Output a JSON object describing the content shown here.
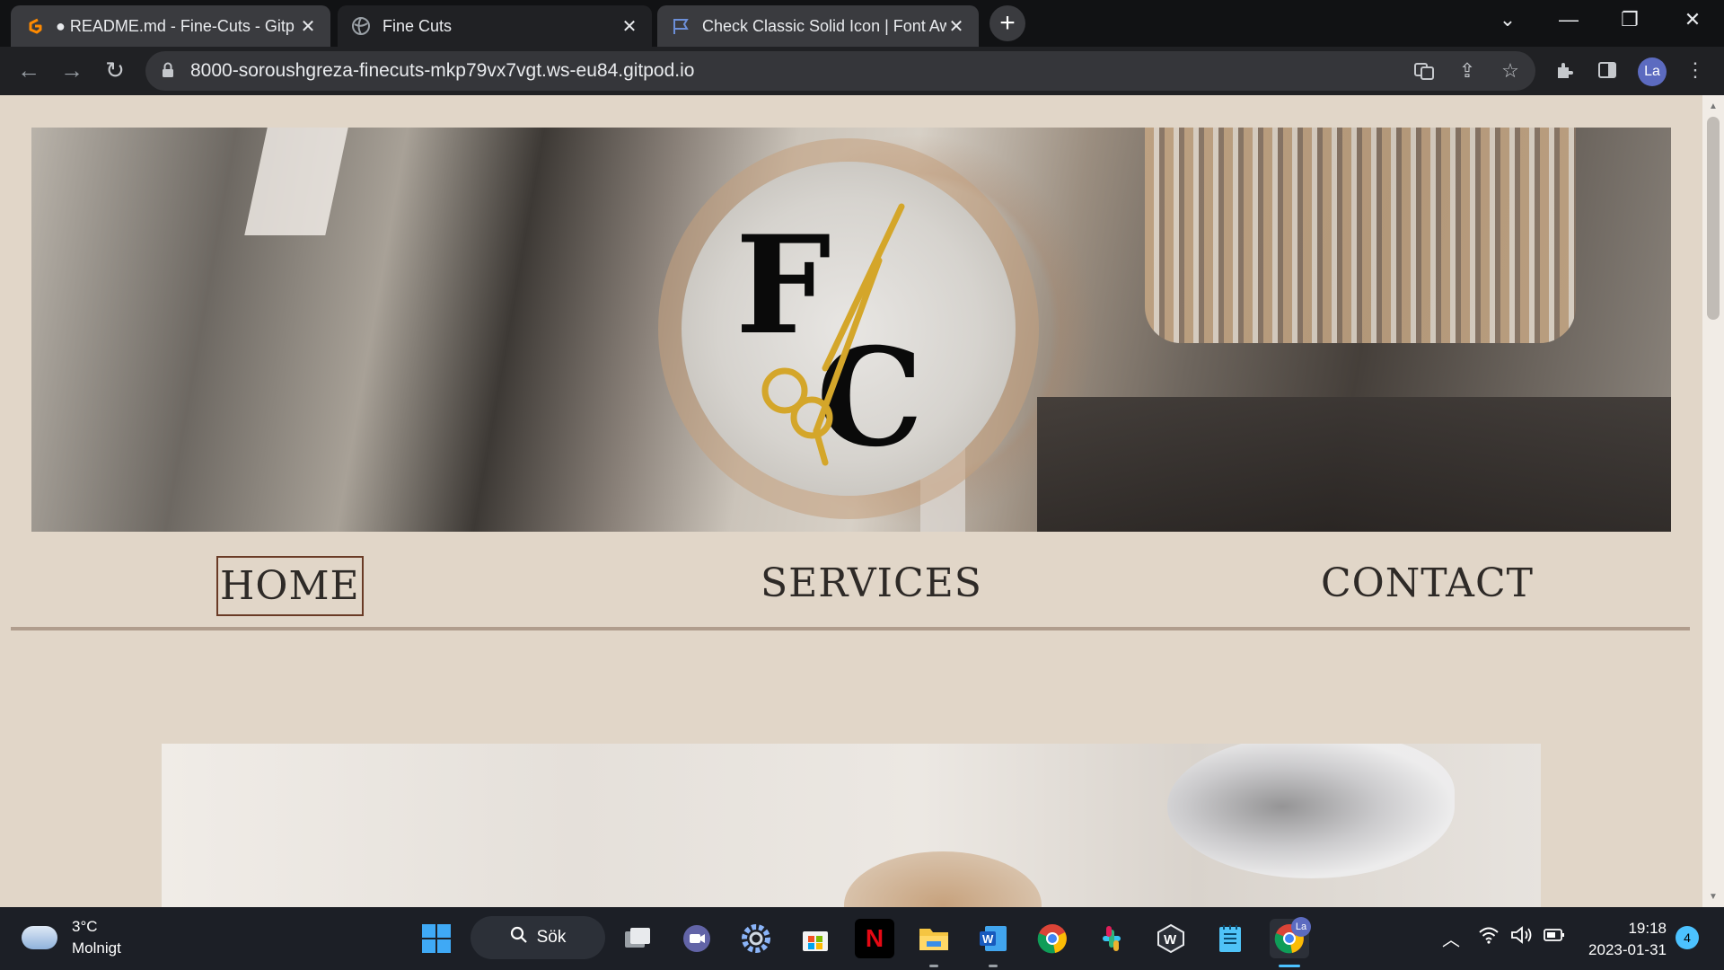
{
  "browser": {
    "tabs": [
      {
        "title": "● README.md - Fine-Cuts - Gitp",
        "favicon": "gitpod-icon"
      },
      {
        "title": "Fine Cuts",
        "favicon": "globe-icon"
      },
      {
        "title": "Check Classic Solid Icon | Font Aw",
        "favicon": "flag-icon"
      }
    ],
    "new_tab_label": "+",
    "url": "8000-soroushgreza-finecuts-mkp79vx7vgt.ws-eu84.gitpod.io",
    "profile_initials": "La"
  },
  "page": {
    "logo": {
      "letter_top": "F",
      "letter_bottom": "C"
    },
    "nav": [
      {
        "label": "HOME",
        "active": true
      },
      {
        "label": "SERVICES",
        "active": false
      },
      {
        "label": "CONTACT",
        "active": false
      }
    ]
  },
  "taskbar": {
    "weather_temp": "3°C",
    "weather_desc": "Molnigt",
    "search_label": "Sök",
    "time": "19:18",
    "date": "2023-01-31",
    "notifications": "4",
    "chrome_profile_badge": "La"
  },
  "colors": {
    "page_bg": "#e1d6c8",
    "nav_active_border": "#6a3b26",
    "nav_divider": "#b09d8d",
    "logo_gold": "#d4a62a"
  }
}
